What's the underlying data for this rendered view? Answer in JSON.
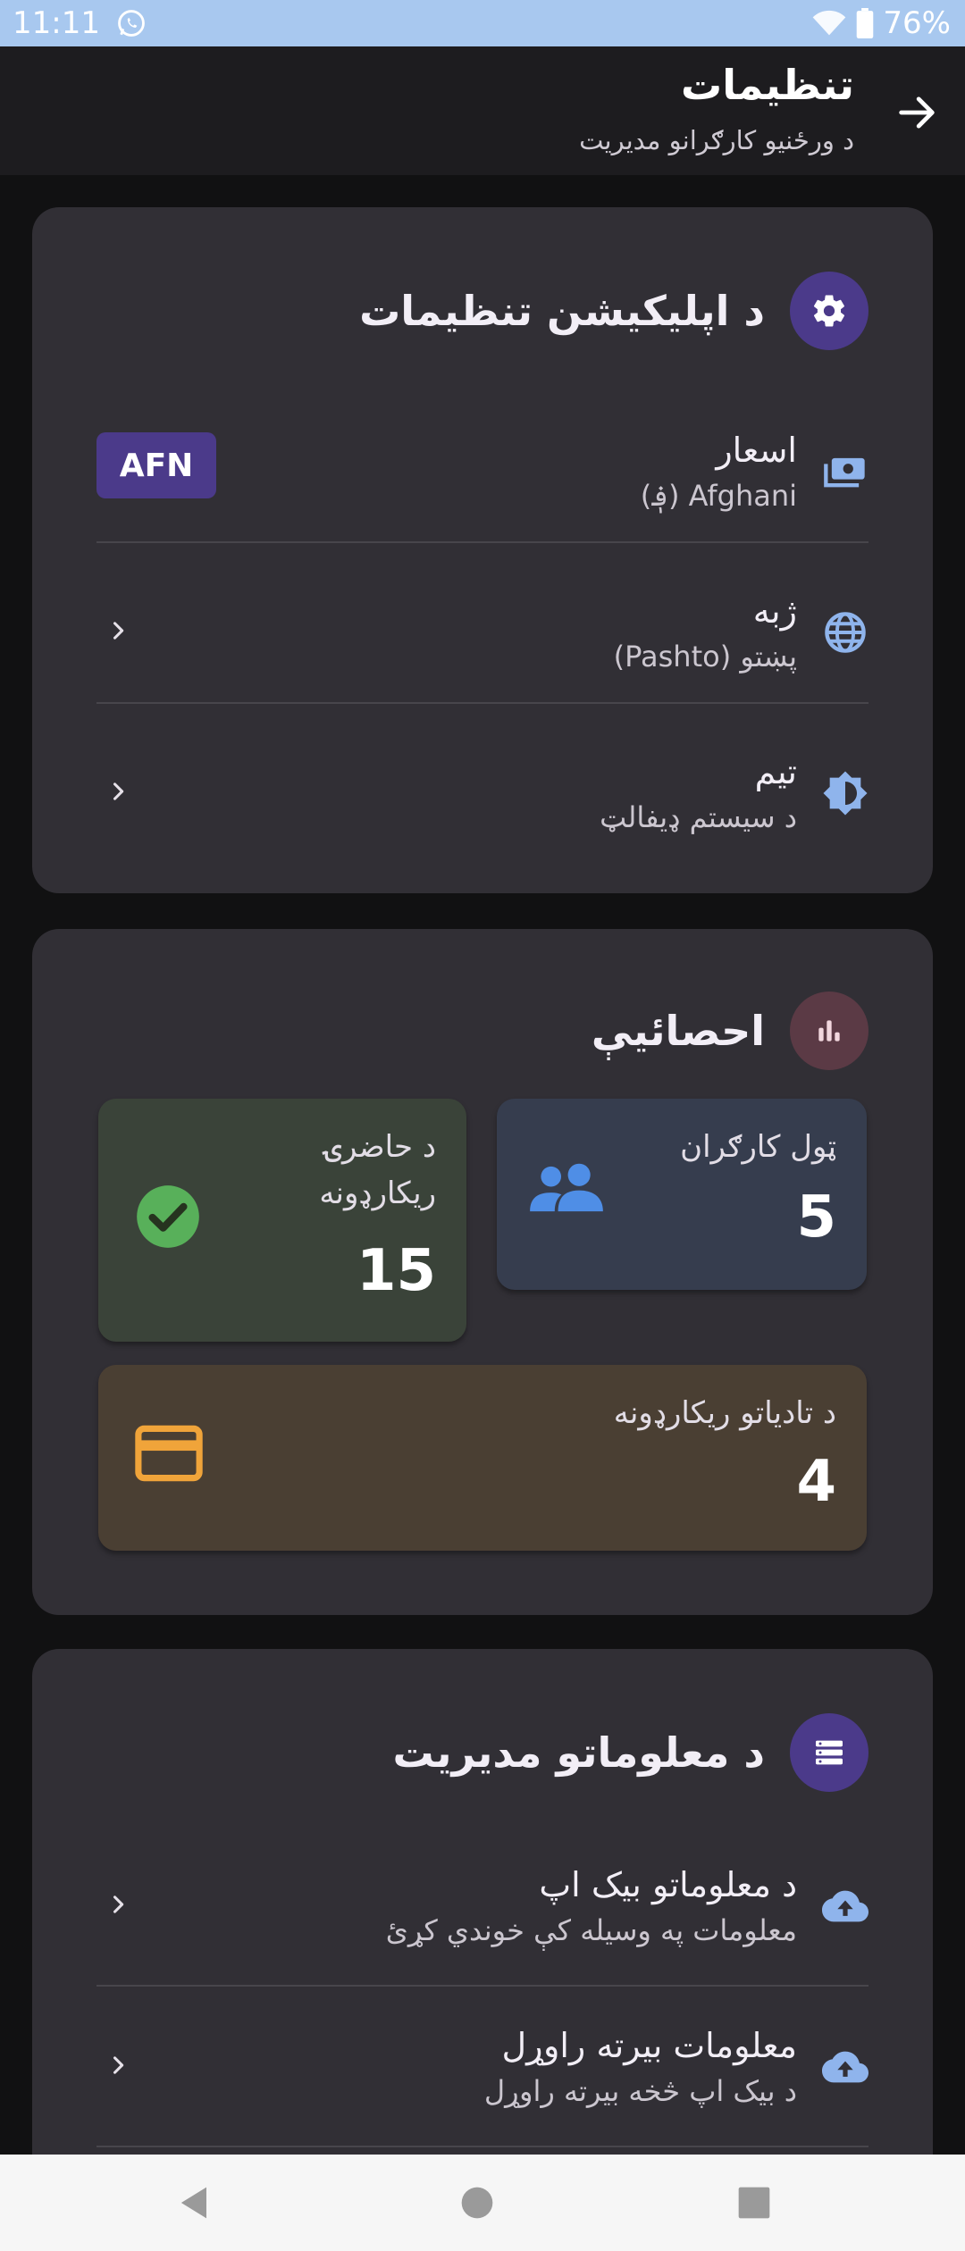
{
  "status_bar": {
    "time": "11:11",
    "battery": "76%"
  },
  "app_bar": {
    "title": "تنظیمات",
    "subtitle": "د ورځنیو کارګرانو مدیریت"
  },
  "app_settings": {
    "title": "د اپلیکیشن تنظیمات",
    "items": [
      {
        "label": "اسعار",
        "value": "Afghani (؋)",
        "badge": "AFN"
      },
      {
        "label": "ژبه",
        "value": "پښتو (Pashto)"
      },
      {
        "label": "تیم",
        "value": "د سیستم ډیفالټ"
      }
    ]
  },
  "statistics": {
    "title": "احصائیې",
    "total_workers": {
      "label": "ټول کارګران",
      "value": "5"
    },
    "attendance_records": {
      "label_line1": "د حاضرۍ",
      "label_line2": "ریکارډونه",
      "value": "15"
    },
    "payment_records": {
      "label": "د تادیاتو ریکارډونه",
      "value": "4"
    }
  },
  "data_management": {
    "title": "د معلوماتو مدیریت",
    "items": [
      {
        "label": "د معلوماتو بیک اپ",
        "value": "معلومات په وسیله کې خوندي کړئ"
      },
      {
        "label": "معلومات بیرته راوړل",
        "value": "د بیک اپ څخه بیرته راوړل"
      }
    ]
  },
  "colors": {
    "accent_purple": "#4b3a8a",
    "accent_blue": "#8fb4ec",
    "stats_icon_bg": "#5b3a45",
    "check_green": "#58b05a",
    "card_orange": "#f0a43a",
    "people_blue": "#4f8ee6"
  }
}
